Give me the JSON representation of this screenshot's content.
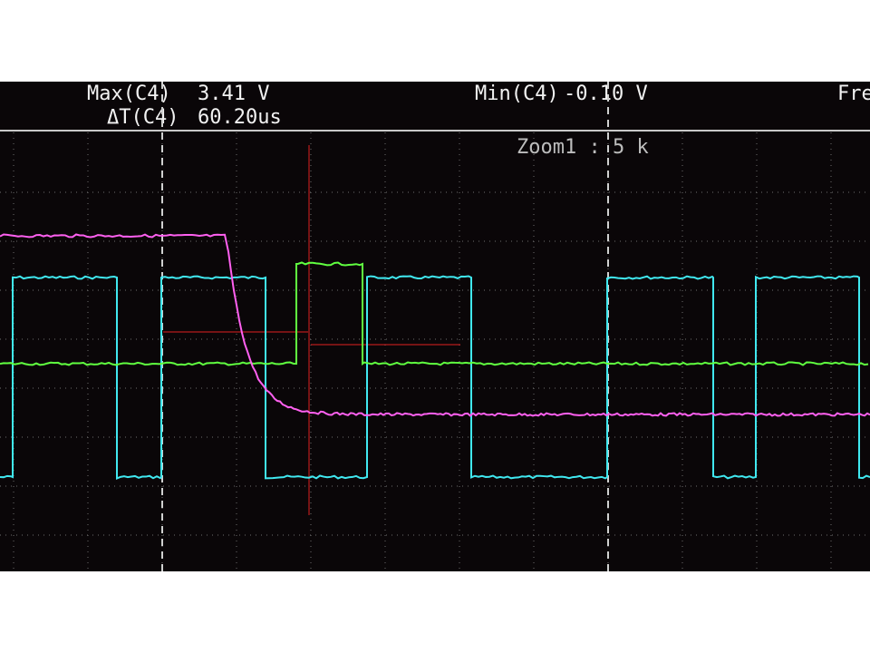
{
  "measurements": {
    "max": {
      "label": "Max(C4)",
      "value": "3.41 V"
    },
    "delta_t": {
      "label": "ΔT(C4)",
      "value": "60.20us"
    },
    "min": {
      "label": "Min(C4)",
      "value": "-0.10 V"
    },
    "freq": {
      "label": "Fre"
    }
  },
  "zoom": {
    "label": "Zoom1 : 5 k"
  },
  "colors": {
    "background": "#0a0608",
    "grid": "#6e6e6e",
    "cursor_dashed": "#d0d0d0",
    "crosshair": "#e02020",
    "ch_magenta": "#ff60f0",
    "ch_cyan": "#40e8f0",
    "ch_green": "#60ff40"
  },
  "traces": {
    "magenta": {
      "name": "C4",
      "description_shape": "step-down exponential"
    },
    "cyan": {
      "name": "",
      "description_shape": "square wave"
    },
    "green": {
      "name": "",
      "description_shape": "single pulse"
    }
  }
}
